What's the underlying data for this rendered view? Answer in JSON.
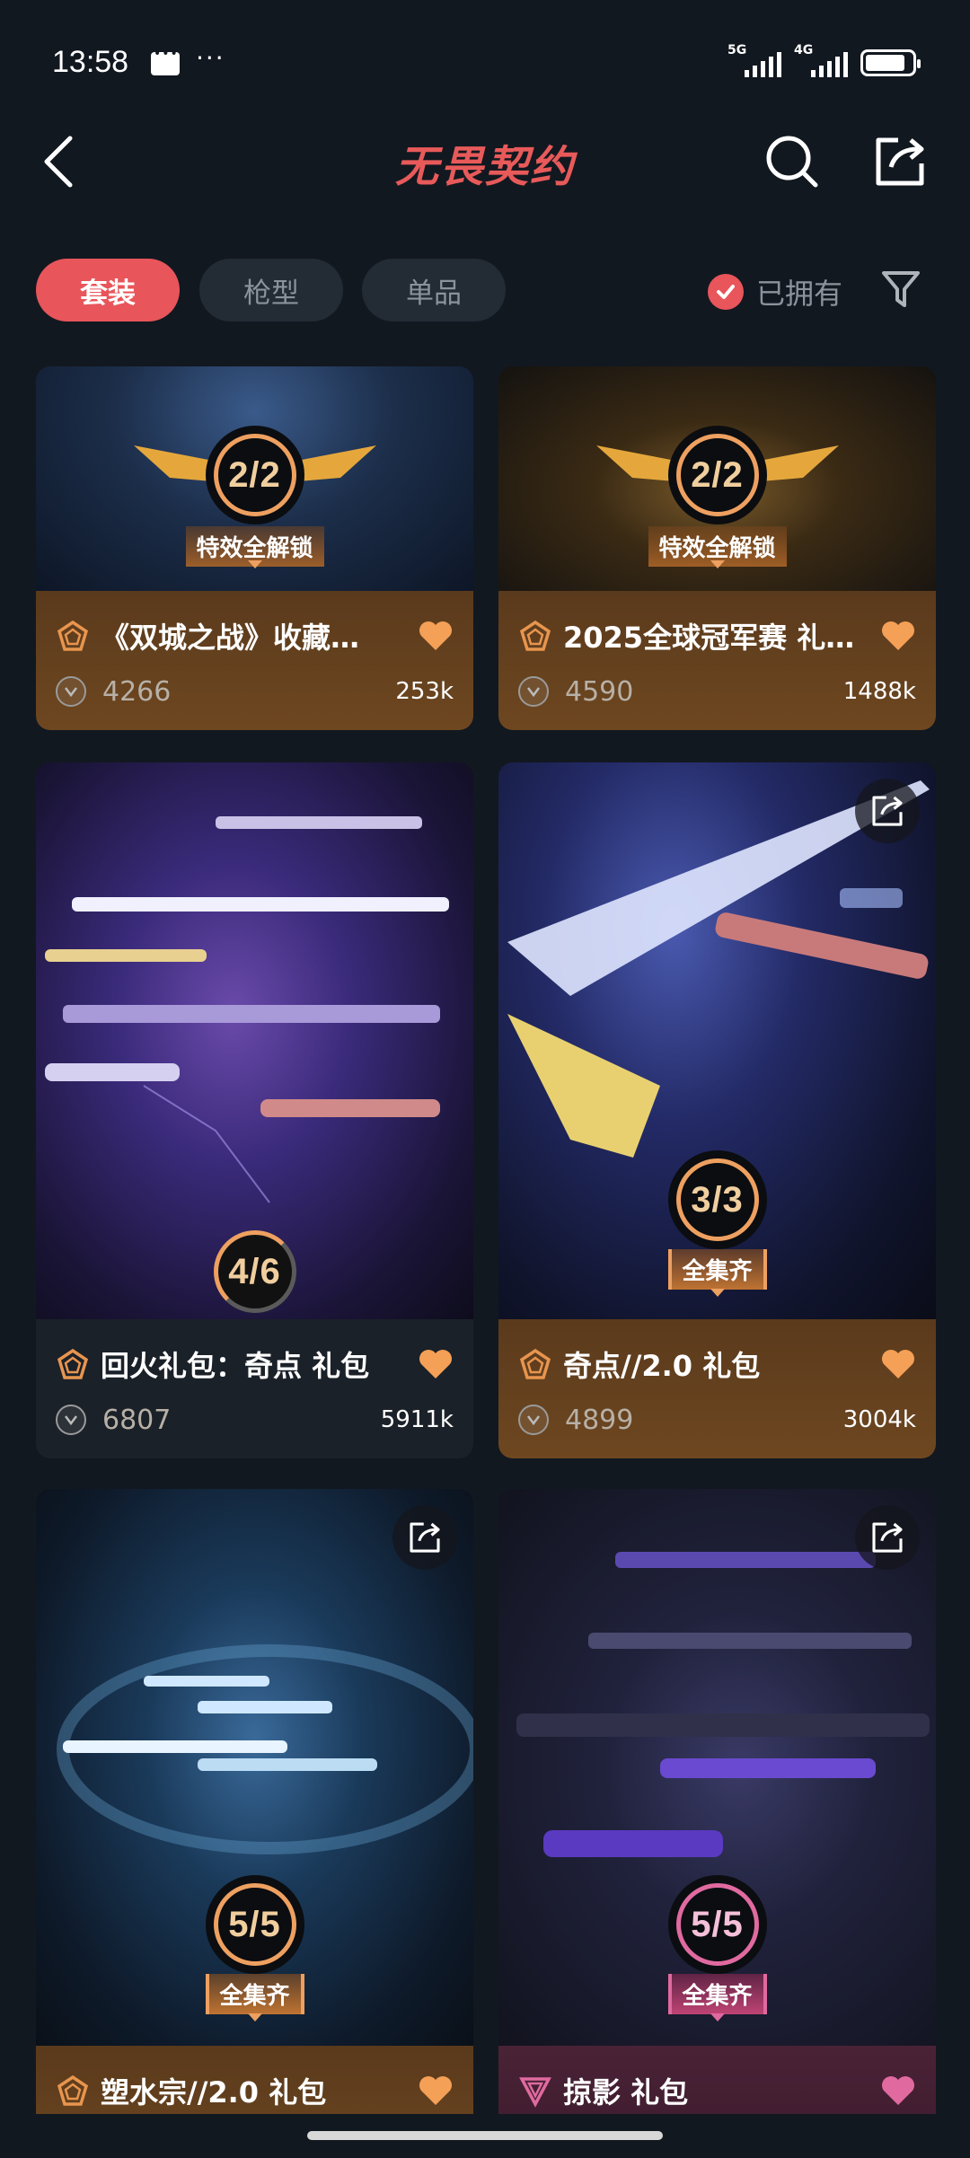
{
  "status_bar": {
    "time": "13:58",
    "net1": "5G",
    "net2": "4G",
    "battery_level": 0.85
  },
  "header": {
    "title": "无畏契约"
  },
  "tabs": [
    {
      "label": "套装",
      "active": true
    },
    {
      "label": "枪型",
      "active": false
    },
    {
      "label": "单品",
      "active": false
    }
  ],
  "filter": {
    "owned_label": "已拥有",
    "owned_checked": true
  },
  "cards": [
    {
      "title": "《双城之战》收藏…",
      "price": "4266",
      "likes": "253k",
      "progress": "2/2",
      "progress_label": "特效全解锁",
      "tier": "premium",
      "theme": "gold",
      "liked": true
    },
    {
      "title": "2025全球冠军赛 礼…",
      "price": "4590",
      "likes": "1488k",
      "progress": "2/2",
      "progress_label": "特效全解锁",
      "tier": "premium",
      "theme": "gold",
      "liked": true
    },
    {
      "title": "回火礼包：奇点 礼包",
      "price": "6807",
      "likes": "5911k",
      "progress": "4/6",
      "progress_label": "",
      "tier": "premium",
      "theme": "dark",
      "liked": true
    },
    {
      "title": "奇点//2.0 礼包",
      "price": "4899",
      "likes": "3004k",
      "progress": "3/3",
      "progress_label": "全集齐",
      "tier": "premium",
      "theme": "gold",
      "liked": true
    },
    {
      "title": "塑水宗//2.0 礼包",
      "price": "",
      "likes": "",
      "progress": "5/5",
      "progress_label": "全集齐",
      "tier": "premium",
      "theme": "gold",
      "liked": true
    },
    {
      "title": "掠影 礼包",
      "price": "",
      "likes": "",
      "progress": "5/5",
      "progress_label": "全集齐",
      "tier": "exclusive",
      "theme": "pink",
      "liked": true
    }
  ],
  "colors": {
    "accent": "#e8555a",
    "gold": "#eea060",
    "heart": "#f4a057",
    "pink": "#e06aa0",
    "bg": "#121820"
  },
  "icons": [
    "back-arrow-icon",
    "search-icon",
    "share-icon",
    "check-icon",
    "filter-funnel-icon",
    "tier-pentagon-icon",
    "tier-triangle-icon",
    "heart-icon",
    "vp-coin-icon"
  ]
}
